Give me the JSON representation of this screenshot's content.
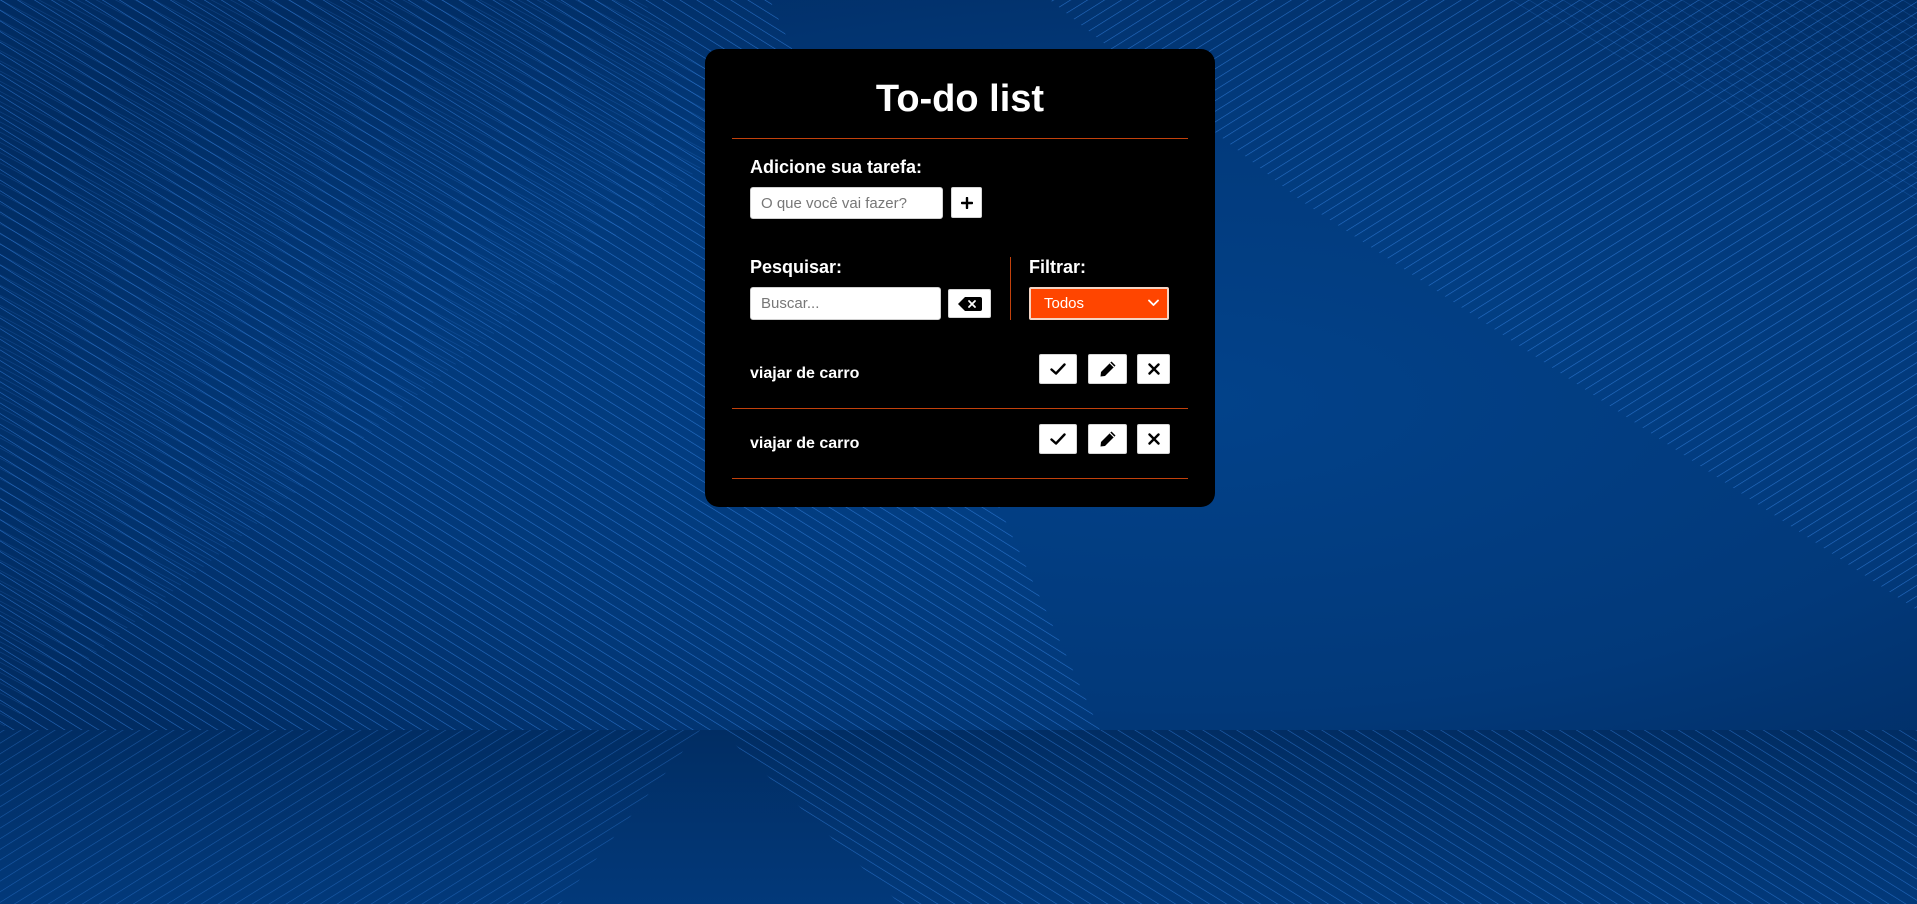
{
  "app": {
    "title": "To-do list"
  },
  "add_task": {
    "label": "Adicione sua tarefa:",
    "placeholder": "O que você vai fazer?",
    "value": "",
    "add_button_icon": "plus-icon"
  },
  "search": {
    "label": "Pesquisar:",
    "placeholder": "Buscar...",
    "value": "",
    "clear_button_icon": "backspace-icon"
  },
  "filter": {
    "label": "Filtrar:",
    "selected": "Todos"
  },
  "todos": [
    {
      "text": "viajar de carro",
      "actions": [
        "check-icon",
        "pencil-icon",
        "x-icon"
      ]
    },
    {
      "text": "viajar de carro",
      "actions": [
        "check-icon",
        "pencil-icon",
        "x-icon"
      ]
    }
  ],
  "colors": {
    "background": "#023c7e",
    "background_line": "#2f7fe0",
    "card": "#000000",
    "accent": "#ff4500",
    "divider": "#c2410c",
    "text": "#ffffff"
  }
}
